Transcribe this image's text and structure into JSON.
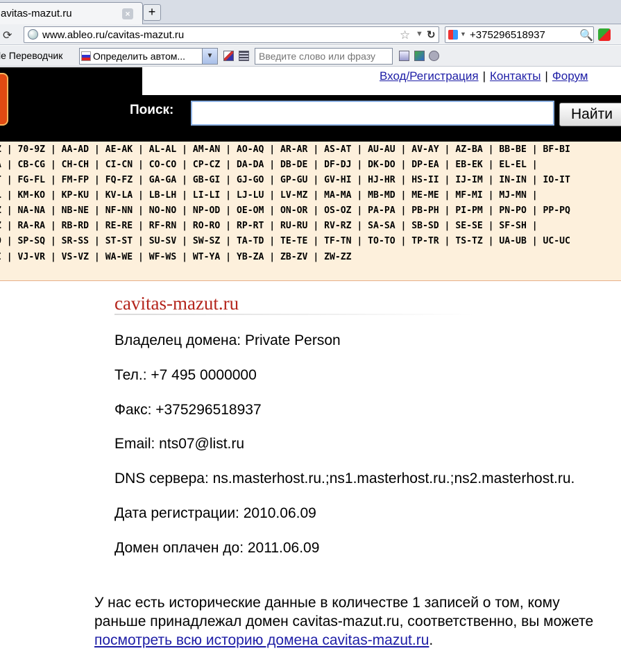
{
  "browser": {
    "tab_title": "avitas-mazut.ru",
    "new_tab": "+",
    "close": "×",
    "url": "www.ableo.ru/cavitas-mazut.ru",
    "search_query": "+375296518937",
    "translator_label": "le Переводчик",
    "translate_select": "Определить автом...",
    "dict_placeholder": "Введите слово или фразу"
  },
  "header": {
    "links": [
      "Вход/Регистрация",
      "Контакты",
      "Форум"
    ],
    "search_label": "Поиск:",
    "search_value": "",
    "search_button": "Найти"
  },
  "index": {
    "lines": [
      [
        "Z",
        "70-9Z",
        "AA-AD",
        "AE-AK",
        "AL-AL",
        "AM-AN",
        "AO-AQ",
        "AR-AR",
        "AS-AT",
        "AU-AU",
        "AV-AY",
        "AZ-BA",
        "BB-BE",
        "BF-BI"
      ],
      [
        "A",
        "CB-CG",
        "CH-CH",
        "CI-CN",
        "CO-CO",
        "CP-CZ",
        "DA-DA",
        "DB-DE",
        "DF-DJ",
        "DK-DO",
        "DP-EA",
        "EB-EK",
        "EL-EL",
        ""
      ],
      [
        "T",
        "FG-FL",
        "FM-FP",
        "FQ-FZ",
        "GA-GA",
        "GB-GI",
        "GJ-GO",
        "GP-GU",
        "GV-HI",
        "HJ-HR",
        "HS-II",
        "IJ-IM",
        "IN-IN",
        "IO-IT"
      ],
      [
        "L",
        "KM-KO",
        "KP-KU",
        "KV-LA",
        "LB-LH",
        "LI-LI",
        "LJ-LU",
        "LV-MZ",
        "MA-MA",
        "MB-MD",
        "ME-ME",
        "MF-MI",
        "MJ-MN",
        ""
      ],
      [
        "Z",
        "NA-NA",
        "NB-NE",
        "NF-NN",
        "NO-NO",
        "NP-OD",
        "OE-OM",
        "ON-OR",
        "OS-OZ",
        "PA-PA",
        "PB-PH",
        "PI-PM",
        "PN-PO",
        "PP-PQ"
      ],
      [
        "Z",
        "RA-RA",
        "RB-RD",
        "RE-RE",
        "RF-RN",
        "RO-RO",
        "RP-RT",
        "RU-RU",
        "RV-RZ",
        "SA-SA",
        "SB-SD",
        "SE-SE",
        "SF-SH",
        ""
      ],
      [
        "O",
        "SP-SQ",
        "SR-SS",
        "ST-ST",
        "SU-SV",
        "SW-SZ",
        "TA-TD",
        "TE-TE",
        "TF-TN",
        "TO-TO",
        "TP-TR",
        "TS-TZ",
        "UA-UB",
        "UC-UC"
      ],
      [
        "I",
        "VJ-VR",
        "VS-VZ",
        "WA-WE",
        "WF-WS",
        "WT-YA",
        "YB-ZA",
        "ZB-ZV",
        "ZW-ZZ"
      ]
    ]
  },
  "domain": {
    "title": "cavitas-mazut.ru",
    "owner": "Владелец домена: Private Person",
    "phone": "Тел.: +7 495 0000000",
    "fax": "Факс: +375296518937",
    "email": "Email: nts07@list.ru",
    "dns": "DNS сервера: ns.masterhost.ru.;ns1.masterhost.ru.;ns2.masterhost.ru.",
    "registered": "Дата регистрации: 2010.06.09",
    "paid_until": "Домен оплачен до: 2011.06.09"
  },
  "history": {
    "text": "У нас есть исторические данные в количестве 1 записей о том, кому раньше принадлежал домен cavitas-mazut.ru, соответственно, вы можете ",
    "link": "посмотреть всю историю домена cavitas-mazut.ru",
    "tail": "."
  }
}
